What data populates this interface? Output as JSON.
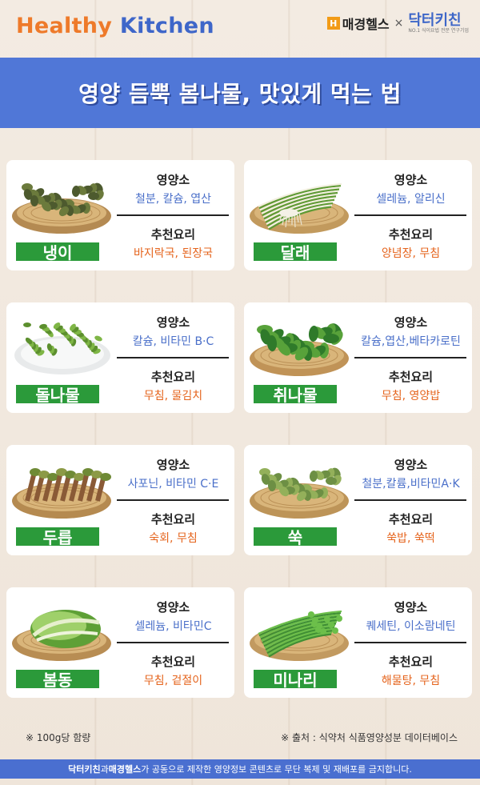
{
  "header": {
    "brand_word1": "Healthy",
    "brand_word2": "Kitchen",
    "partner_mk_badge": "H",
    "partner_mk": "매경헬스",
    "partner_x": "×",
    "partner_dk": "닥터키친",
    "partner_dk_sub": "NO.1 식이요법 전문 연구기업"
  },
  "banner": {
    "title": "영양 듬뿍 봄나물, 맛있게 먹는 법"
  },
  "labels": {
    "nutrient": "영양소",
    "dish": "추천요리"
  },
  "items": [
    {
      "name": "냉이",
      "nutrients": "철분, 칼슘, 엽산",
      "dishes": "바지락국, 된장국",
      "icon": "naengi-basket-photo"
    },
    {
      "name": "달래",
      "nutrients": "셀레늄, 알리신",
      "dishes": "양념장, 무침",
      "icon": "dallae-basket-photo"
    },
    {
      "name": "돌나물",
      "nutrients": "칼슘, 비타민 B·C",
      "dishes": "무침, 물김치",
      "icon": "dolnamul-plate-photo"
    },
    {
      "name": "취나물",
      "nutrients": "칼슘,엽산,베타카로틴",
      "dishes": "무침, 영양밥",
      "icon": "chwinamul-basket-photo"
    },
    {
      "name": "두릅",
      "nutrients": "사포닌, 비타민 C·E",
      "dishes": "숙회, 무침",
      "icon": "dureup-basket-photo"
    },
    {
      "name": "쑥",
      "nutrients": "철분,칼륨,비타민A·K",
      "dishes": "쑥밥, 쑥떡",
      "icon": "ssuk-basket-photo"
    },
    {
      "name": "봄동",
      "nutrients": "셀레늄, 비타민C",
      "dishes": "무침, 겉절이",
      "icon": "bomdong-basket-photo"
    },
    {
      "name": "미나리",
      "nutrients": "퀘세틴, 이소람네틴",
      "dishes": "해물탕, 무침",
      "icon": "minari-basket-photo"
    }
  ],
  "notes": {
    "left": "※ 100g당 함량",
    "right": "※ 출처 : 식약처 식품영양성분 데이터베이스"
  },
  "footer": {
    "b1": "닥터키친",
    "t1": "과 ",
    "b2": "매경헬스",
    "t2": "가 공동으로 제작한 영양정보 콘텐츠로 무단 복제 및 재배포를 금지합니다."
  },
  "colors": {
    "banner": "#5077d7",
    "name_badge": "#2b9a3a",
    "nutrient_text": "#4a6fc9",
    "dish_text": "#e5641d",
    "brand_orange": "#ee7a2a",
    "brand_blue": "#3e66c9"
  }
}
